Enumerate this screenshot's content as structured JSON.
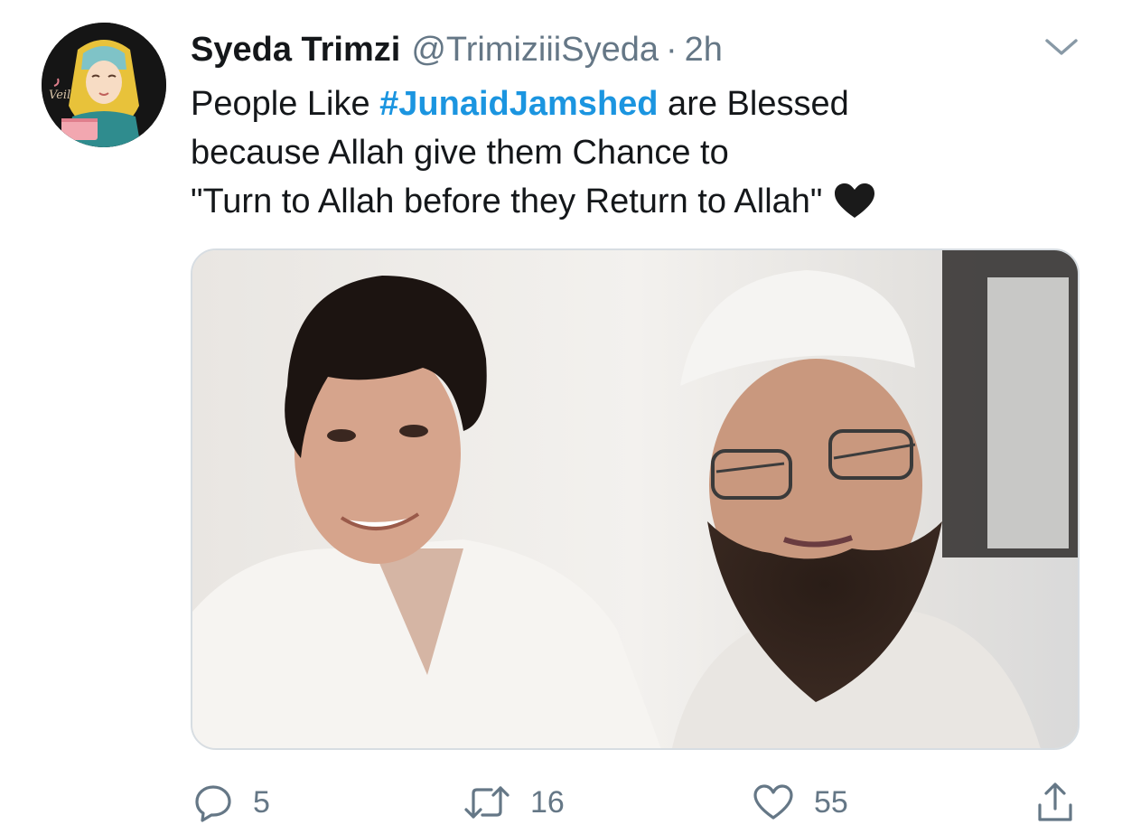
{
  "tweet": {
    "author": {
      "display_name": "Syeda Trimzi",
      "handle": "@TrimiziiiSyeda",
      "avatar_label": "Veil"
    },
    "separator": "·",
    "timestamp": "2h",
    "text": {
      "line1_before": "People Like ",
      "hashtag": "#JunaidJamshed",
      "line1_after": " are Blessed",
      "line2": "because Allah give them Chance to",
      "line3": "\"Turn to Allah before they Return to Allah\"",
      "emoji": "black-heart-icon"
    },
    "media": {
      "description_icons": [
        "photo-left-person",
        "photo-right-person"
      ]
    },
    "actions": {
      "reply_count": "5",
      "retweet_count": "16",
      "like_count": "55"
    }
  },
  "colors": {
    "hashtag": "#1b95e0",
    "secondary_text": "#657786",
    "primary_text": "#14171a",
    "media_border": "#d7dde2"
  }
}
